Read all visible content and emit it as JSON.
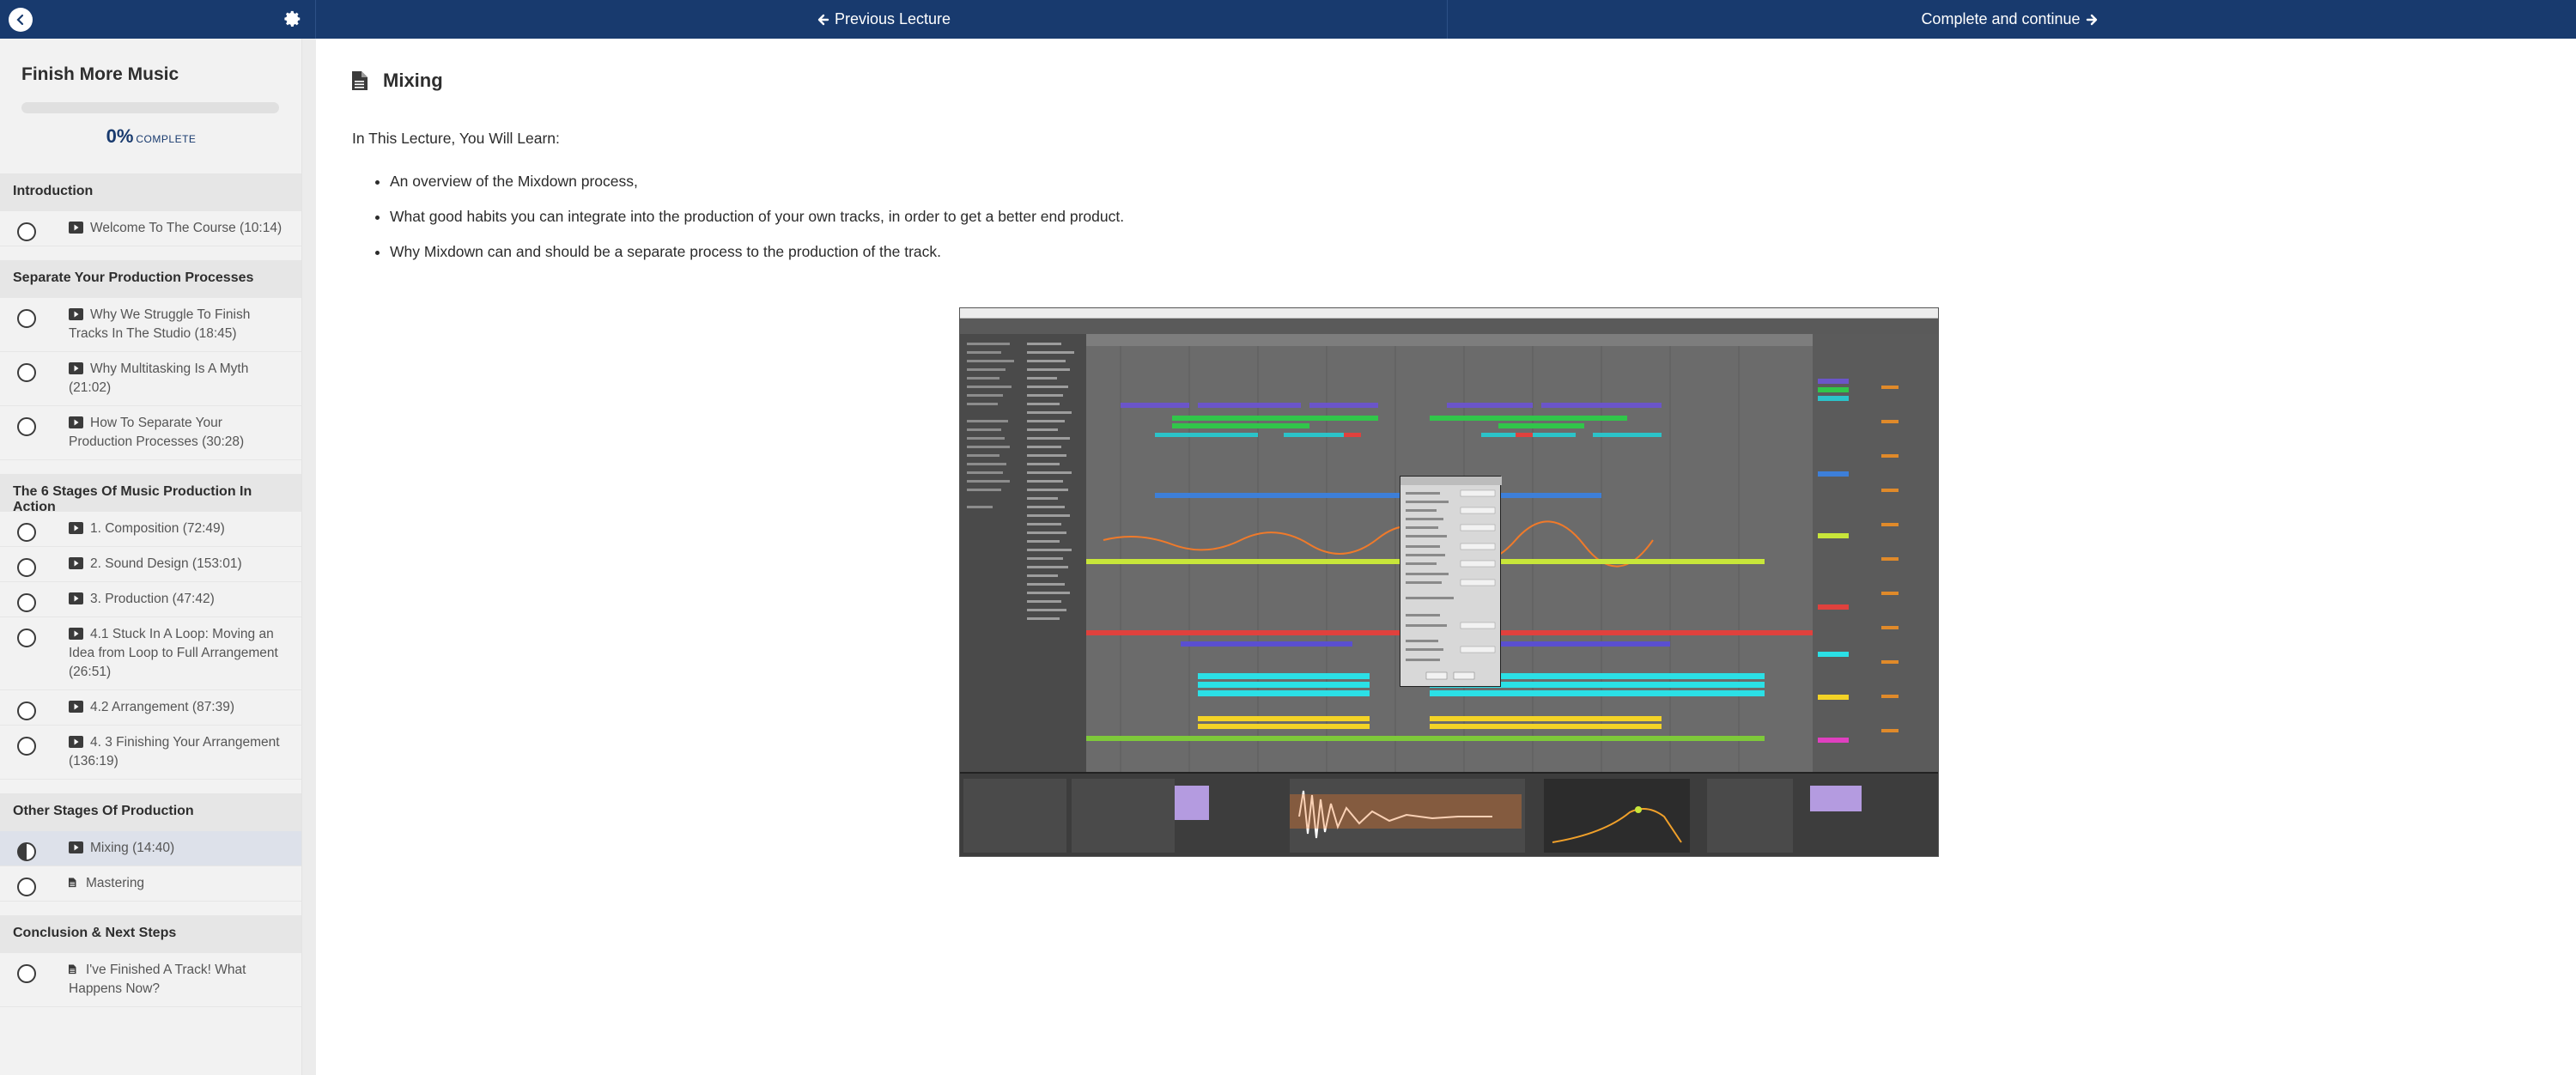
{
  "topbar": {
    "prev_label": "Previous Lecture",
    "next_label": "Complete and continue",
    "colors": {
      "bar": "#183a6e",
      "text": "#ffffff"
    }
  },
  "sidebar": {
    "course_title": "Finish More Music",
    "progress": {
      "percent": 0,
      "percent_label": "0%",
      "word": "COMPLETE"
    },
    "sections": [
      {
        "title": "Introduction",
        "lectures": [
          {
            "label": "Welcome To The Course (10:14)",
            "type": "video",
            "status": "not-started"
          }
        ]
      },
      {
        "title": "Separate Your Production Processes",
        "lectures": [
          {
            "label": "Why We Struggle To Finish Tracks In The Studio (18:45)",
            "type": "video",
            "status": "not-started"
          },
          {
            "label": "Why Multitasking Is A Myth (21:02)",
            "type": "video",
            "status": "not-started"
          },
          {
            "label": "How To Separate Your Production Processes (30:28)",
            "type": "video",
            "status": "not-started"
          }
        ]
      },
      {
        "title": "The 6 Stages Of Music Production In Action",
        "lectures": [
          {
            "label": "1. Composition (72:49)",
            "type": "video",
            "status": "not-started"
          },
          {
            "label": "2. Sound Design (153:01)",
            "type": "video",
            "status": "not-started"
          },
          {
            "label": "3. Production (47:42)",
            "type": "video",
            "status": "not-started"
          },
          {
            "label": "4.1 Stuck In A Loop: Moving an Idea from Loop to Full Arrangement (26:51)",
            "type": "video",
            "status": "not-started"
          },
          {
            "label": "4.2 Arrangement (87:39)",
            "type": "video",
            "status": "not-started"
          },
          {
            "label": "4. 3 Finishing Your Arrangement (136:19)",
            "type": "video",
            "status": "not-started"
          }
        ]
      },
      {
        "title": "Other Stages Of Production",
        "lectures": [
          {
            "label": "Mixing (14:40)",
            "type": "video",
            "status": "in-progress",
            "active": true
          },
          {
            "label": "Mastering",
            "type": "text",
            "status": "not-started"
          }
        ]
      },
      {
        "title": "Conclusion & Next Steps",
        "lectures": [
          {
            "label": "I've Finished A Track! What Happens Now?",
            "type": "text",
            "status": "not-started"
          }
        ]
      }
    ]
  },
  "main": {
    "lecture_title": "Mixing",
    "intro": "In This Lecture, You Will Learn:",
    "bullets": [
      "An overview of the Mixdown process,",
      "What good habits you can integrate into the production of your own tracks, in order to get a better end product.",
      "Why Mixdown can and should be a separate process to the production of the track."
    ]
  }
}
